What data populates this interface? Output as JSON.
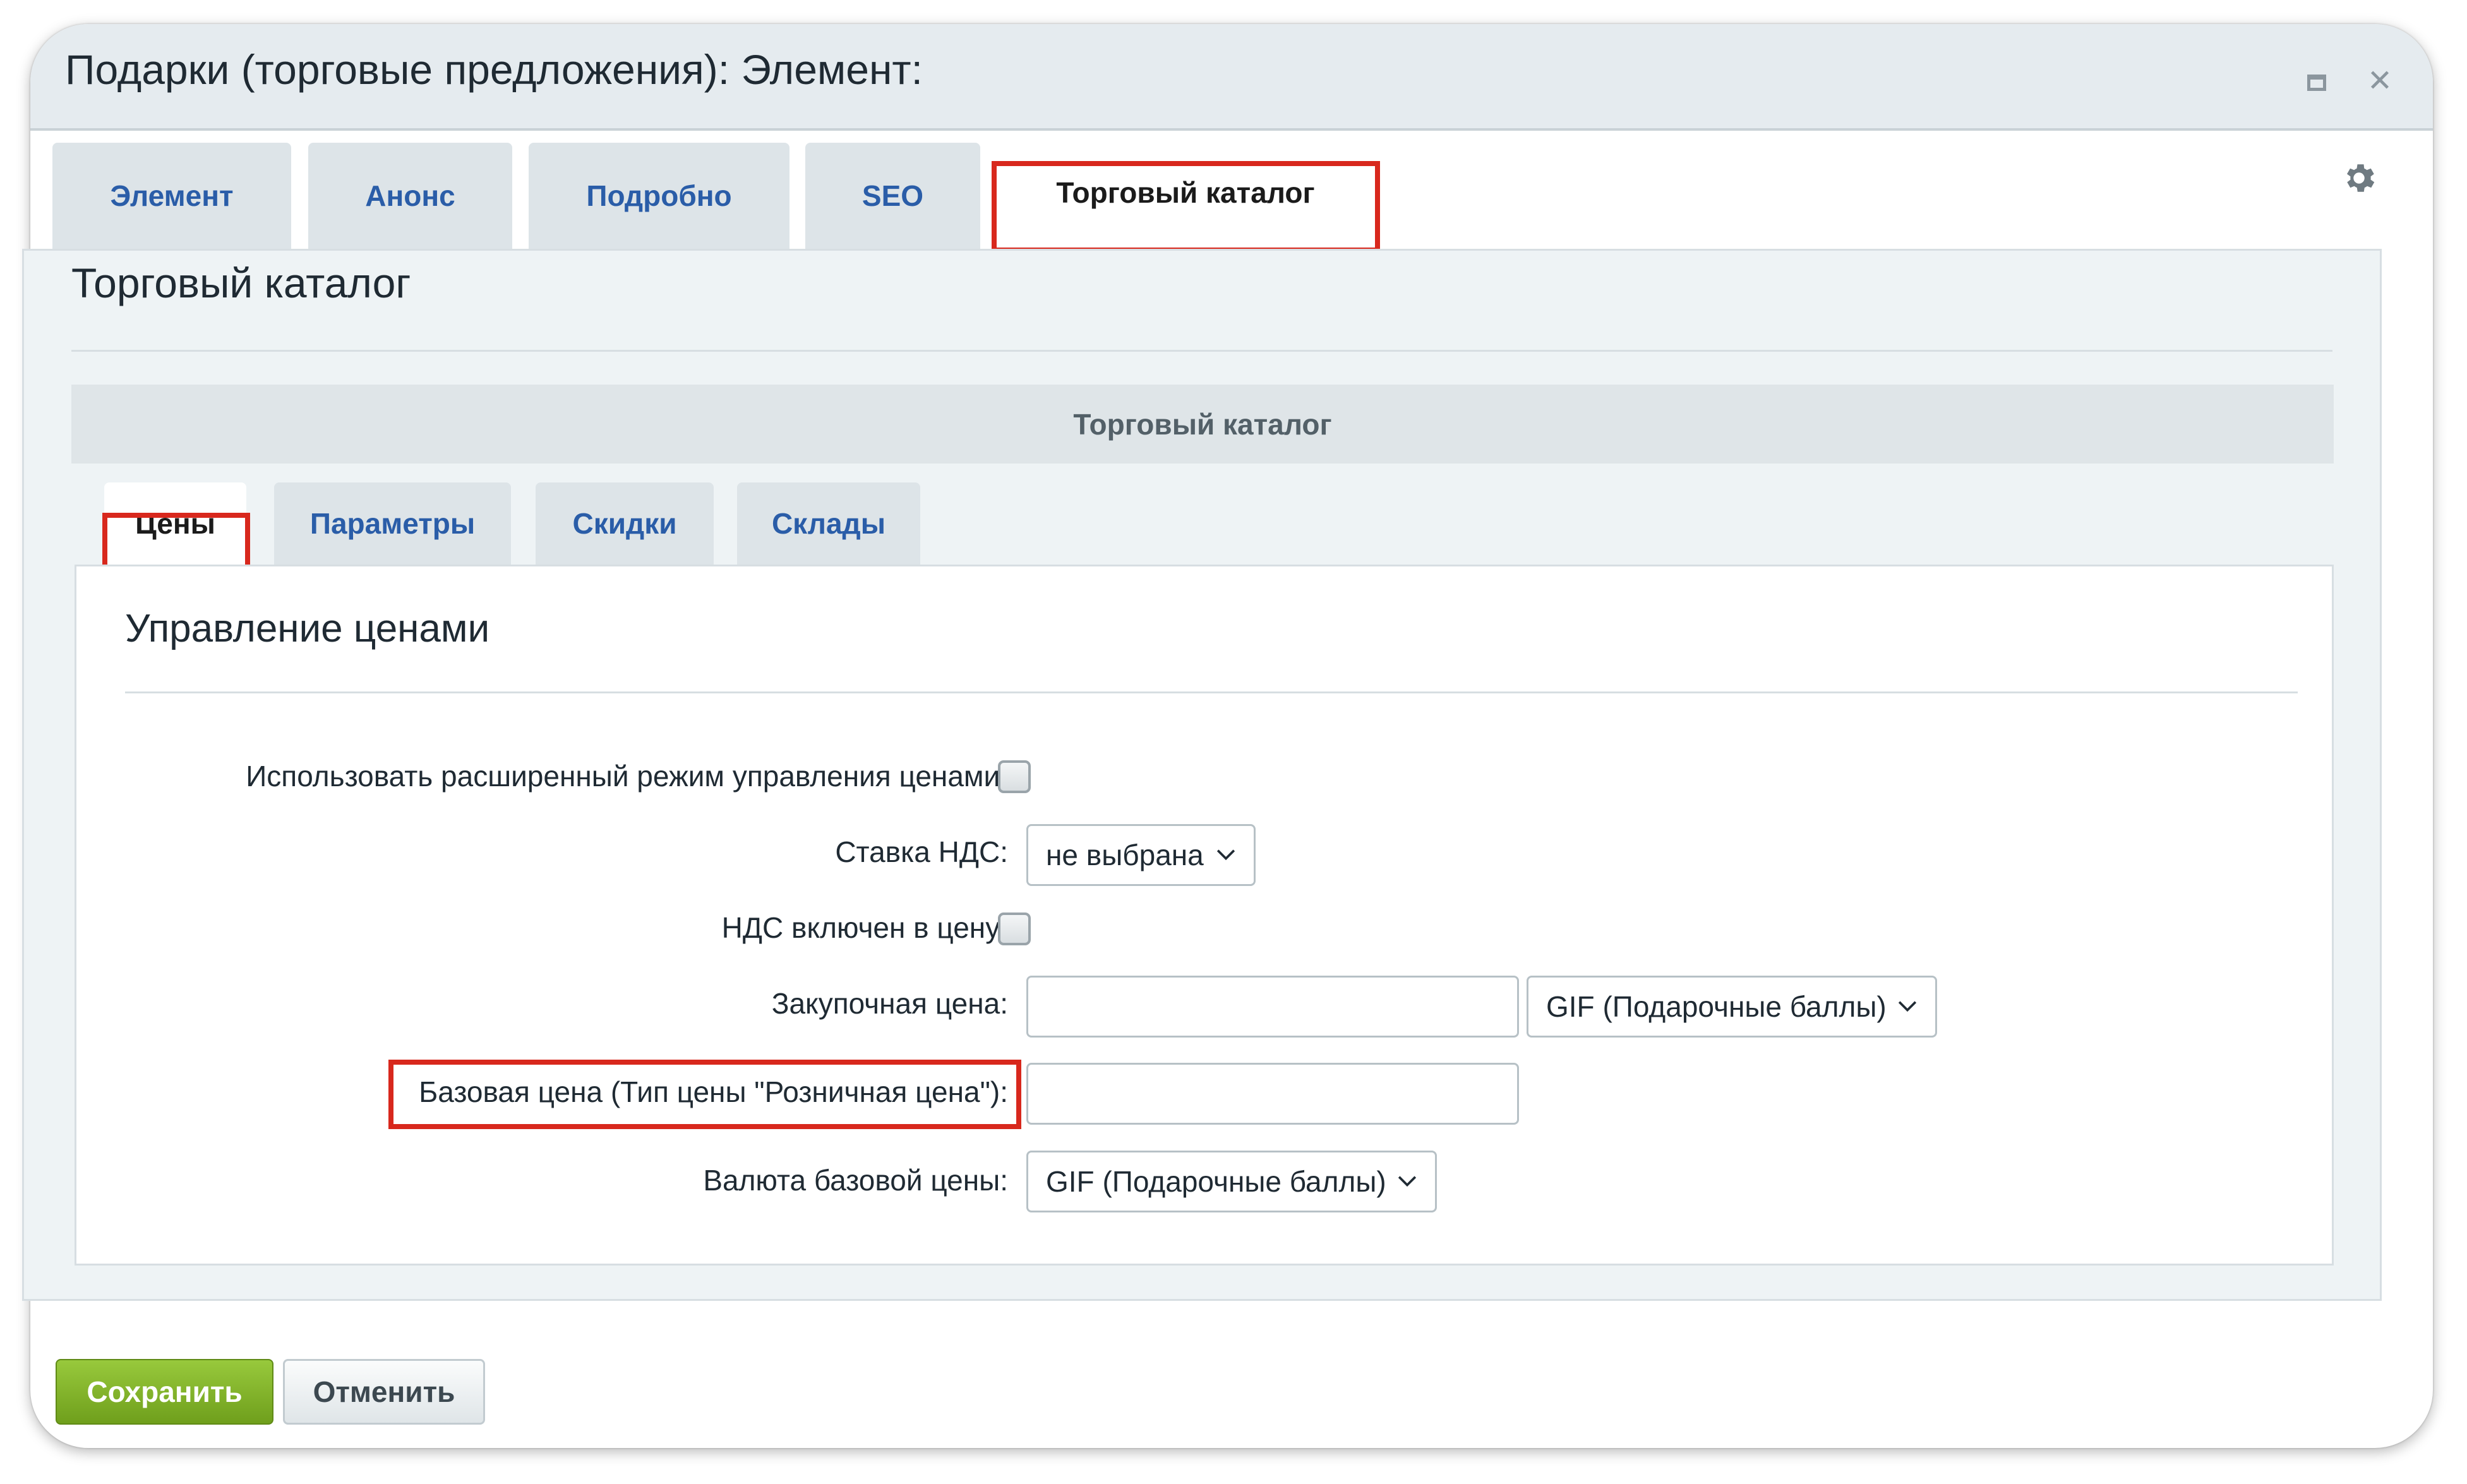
{
  "window": {
    "title": "Подарки (торговые предложения): Элемент:"
  },
  "tabs": [
    {
      "label": "Элемент"
    },
    {
      "label": "Анонс"
    },
    {
      "label": "Подробно"
    },
    {
      "label": "SEO"
    },
    {
      "label": "Торговый каталог",
      "active": true
    }
  ],
  "section": {
    "title": "Торговый каталог",
    "bar_label": "Торговый каталог"
  },
  "subtabs": [
    {
      "label": "Цены",
      "active": true
    },
    {
      "label": "Параметры"
    },
    {
      "label": "Скидки"
    },
    {
      "label": "Склады"
    }
  ],
  "prices": {
    "heading": "Управление ценами",
    "extended_mode_label": "Использовать расширенный режим управления ценами:",
    "vat_rate_label": "Ставка НДС:",
    "vat_rate_value": "не выбрана",
    "vat_included_label": "НДС включен в цену:",
    "purchase_price_label": "Закупочная цена:",
    "purchase_price_value": "",
    "purchase_currency_value": "GIF (Подарочные баллы)",
    "base_price_label": "Базовая цена (Тип цены \"Розничная цена\"):",
    "base_price_value": "",
    "base_currency_label": "Валюта базовой цены:",
    "base_currency_value": "GIF (Подарочные баллы)"
  },
  "footer": {
    "save_label": "Сохранить",
    "cancel_label": "Отменить"
  },
  "colors": {
    "highlight": "#d8281d",
    "link_tab": "#2a5da8",
    "save_button": "#7fb126"
  }
}
